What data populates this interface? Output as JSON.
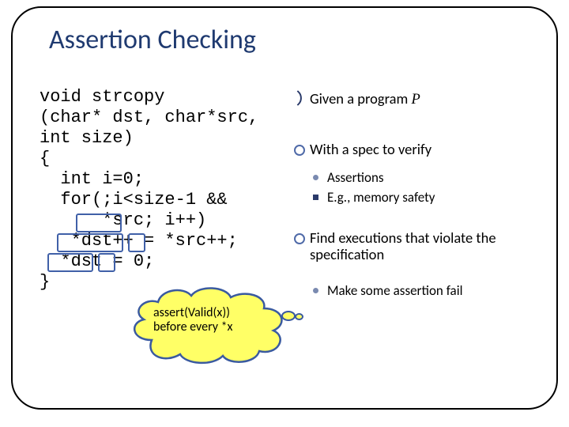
{
  "title": "Assertion Checking",
  "code": {
    "l1": "void strcopy",
    "l2": "(char* dst, char*src,",
    "l3": "int size)",
    "l4": "{",
    "l5": "  int i=0;",
    "l6": "  for(;i<size-1 &&",
    "l7": "      *src; i++)",
    "l8": "   *dst++ = *src++;",
    "l9": "  *dst = 0;",
    "l10": "}"
  },
  "bullets": {
    "b1_prefix": "Given a program ",
    "b1_suffix": "P",
    "b2": "With a spec to verify",
    "b2a": "Assertions",
    "b2b": "E.g., memory safety",
    "b3": "Find executions that violate the specification",
    "b3a": "Make some assertion fail"
  },
  "callout": {
    "line1": "assert(Valid(x))",
    "line2": "before every *x"
  }
}
